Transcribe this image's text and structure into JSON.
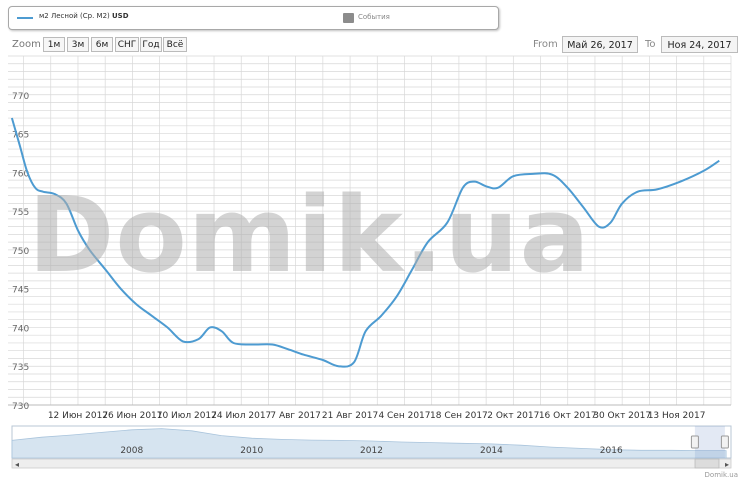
{
  "legend": {
    "series_name": "м2 Лесной (Ср. М2)",
    "series_unit": "USD",
    "events_label": "События"
  },
  "zoom": {
    "label": "Zoom",
    "buttons": [
      "1м",
      "3м",
      "6м",
      "СНГ",
      "Год",
      "Всё"
    ]
  },
  "range": {
    "from_label": "From",
    "from_value": "Май 26, 2017",
    "to_label": "To",
    "to_value": "Ноя 24, 2017"
  },
  "watermark": "Domik.ua",
  "credit": "Domik.ua",
  "colors": {
    "series": "#4d9bd1",
    "grid": "#d8d8d8",
    "navigator_fill": "#d6e4f0"
  },
  "chart_data": {
    "type": "line",
    "series": [
      {
        "name": "м2 Лесной (Ср. М2)",
        "points": [
          [
            "2017-05-26",
            767
          ],
          [
            "2017-05-28",
            763.5
          ],
          [
            "2017-05-30",
            760
          ],
          [
            "2017-06-01",
            758
          ],
          [
            "2017-06-03",
            757.5
          ],
          [
            "2017-06-06",
            757.2
          ],
          [
            "2017-06-09",
            756
          ],
          [
            "2017-06-12",
            752.5
          ],
          [
            "2017-06-15",
            750
          ],
          [
            "2017-06-19",
            747.5
          ],
          [
            "2017-06-23",
            745
          ],
          [
            "2017-06-27",
            743
          ],
          [
            "2017-07-01",
            741.5
          ],
          [
            "2017-07-05",
            740
          ],
          [
            "2017-07-09",
            738.2
          ],
          [
            "2017-07-13",
            738.5
          ],
          [
            "2017-07-16",
            740
          ],
          [
            "2017-07-19",
            739.5
          ],
          [
            "2017-07-22",
            738
          ],
          [
            "2017-07-27",
            737.8
          ],
          [
            "2017-08-01",
            737.8
          ],
          [
            "2017-08-05",
            737.2
          ],
          [
            "2017-08-09",
            736.5
          ],
          [
            "2017-08-14",
            735.8
          ],
          [
            "2017-08-18",
            735
          ],
          [
            "2017-08-22",
            735.5
          ],
          [
            "2017-08-25",
            739.5
          ],
          [
            "2017-08-29",
            741.5
          ],
          [
            "2017-09-02",
            744
          ],
          [
            "2017-09-06",
            747.5
          ],
          [
            "2017-09-10",
            751
          ],
          [
            "2017-09-15",
            753.5
          ],
          [
            "2017-09-19",
            758
          ],
          [
            "2017-09-22",
            758.8
          ],
          [
            "2017-09-25",
            758.2
          ],
          [
            "2017-09-28",
            758
          ],
          [
            "2017-10-02",
            759.5
          ],
          [
            "2017-10-07",
            759.8
          ],
          [
            "2017-10-12",
            759.7
          ],
          [
            "2017-10-16",
            758
          ],
          [
            "2017-10-20",
            755.5
          ],
          [
            "2017-10-24",
            753
          ],
          [
            "2017-10-27",
            753.5
          ],
          [
            "2017-10-30",
            756
          ],
          [
            "2017-11-03",
            757.5
          ],
          [
            "2017-11-08",
            757.8
          ],
          [
            "2017-11-14",
            758.8
          ],
          [
            "2017-11-20",
            760.2
          ],
          [
            "2017-11-24",
            761.5
          ]
        ]
      }
    ],
    "x_range": [
      "2017-05-25",
      "2017-11-27"
    ],
    "ylim": [
      730,
      775
    ],
    "yticks": [
      730,
      735,
      740,
      745,
      750,
      755,
      760,
      765,
      770
    ],
    "x_ticks": [
      {
        "date": "2017-06-12",
        "label": "12 Июн 2017"
      },
      {
        "date": "2017-06-26",
        "label": "26 Июн 2017"
      },
      {
        "date": "2017-07-10",
        "label": "10 Июл 2017"
      },
      {
        "date": "2017-07-24",
        "label": "24 Июл 2017"
      },
      {
        "date": "2017-08-07",
        "label": "7 Авг 2017"
      },
      {
        "date": "2017-08-21",
        "label": "21 Авг 2017"
      },
      {
        "date": "2017-09-04",
        "label": "4 Сен 2017"
      },
      {
        "date": "2017-09-18",
        "label": "18 Сен 2017"
      },
      {
        "date": "2017-10-02",
        "label": "2 Окт 2017"
      },
      {
        "date": "2017-10-16",
        "label": "16 Окт 2017"
      },
      {
        "date": "2017-10-30",
        "label": "30 Окт 2017"
      },
      {
        "date": "2017-11-13",
        "label": "13 Ноя 2017"
      }
    ],
    "grid": true,
    "navigator": {
      "x_range": [
        "2006-01-01",
        "2017-12-31"
      ],
      "year_labels": [
        "2008",
        "2010",
        "2012",
        "2014",
        "2016"
      ],
      "series": [
        [
          "2006-01",
          0.55
        ],
        [
          "2006-07",
          0.65
        ],
        [
          "2007-01",
          0.72
        ],
        [
          "2007-07",
          0.8
        ],
        [
          "2008-01",
          0.88
        ],
        [
          "2008-07",
          0.92
        ],
        [
          "2009-01",
          0.85
        ],
        [
          "2009-07",
          0.7
        ],
        [
          "2010-01",
          0.62
        ],
        [
          "2010-07",
          0.58
        ],
        [
          "2011-01",
          0.56
        ],
        [
          "2011-07",
          0.55
        ],
        [
          "2012-01",
          0.53
        ],
        [
          "2012-07",
          0.5
        ],
        [
          "2013-01",
          0.48
        ],
        [
          "2013-07",
          0.46
        ],
        [
          "2014-01",
          0.44
        ],
        [
          "2014-07",
          0.4
        ],
        [
          "2015-01",
          0.34
        ],
        [
          "2015-07",
          0.3
        ],
        [
          "2016-01",
          0.26
        ],
        [
          "2016-07",
          0.24
        ],
        [
          "2017-01",
          0.24
        ],
        [
          "2017-07",
          0.23
        ],
        [
          "2017-12",
          0.23
        ]
      ]
    }
  }
}
